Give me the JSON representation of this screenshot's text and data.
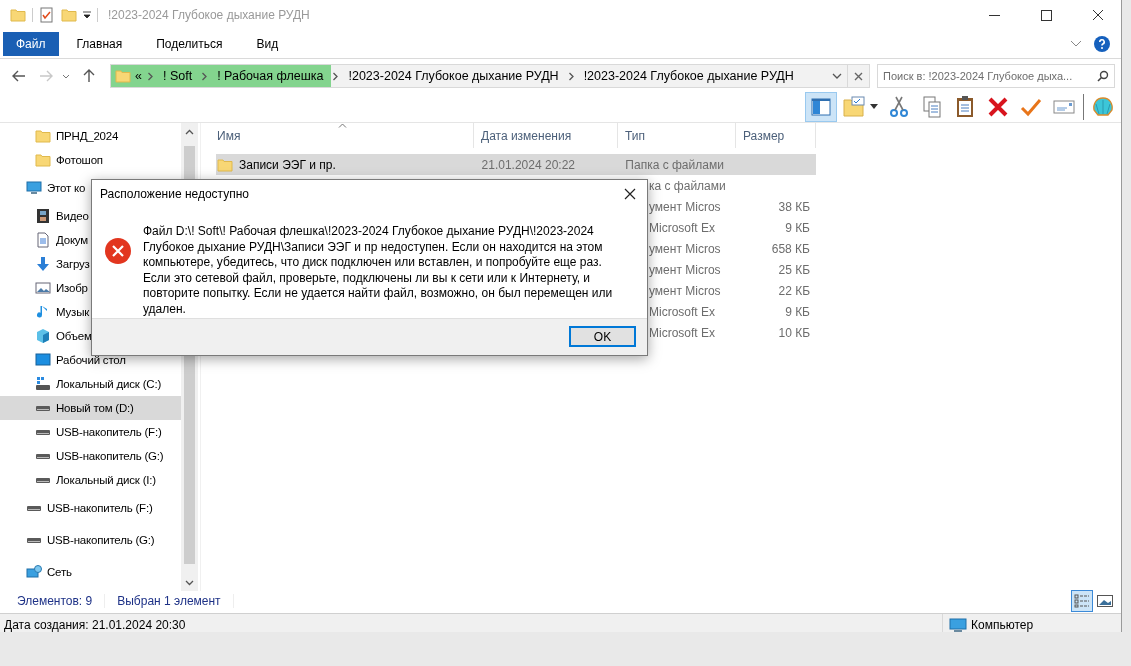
{
  "window": {
    "title": "!2023-2024 Глубокое дыхание РУДН"
  },
  "ribbon": {
    "tabs": [
      {
        "label": "Файл",
        "kind": "file"
      },
      {
        "label": "Главная",
        "kind": "tab"
      },
      {
        "label": "Поделиться",
        "kind": "tab"
      },
      {
        "label": "Вид",
        "kind": "tab"
      }
    ]
  },
  "address": {
    "crumbs": [
      {
        "label": "«",
        "highlighted": true
      },
      {
        "label": "! Soft",
        "highlighted": true
      },
      {
        "label": "! Рабочая флешка",
        "highlighted": true
      },
      {
        "label": "!2023-2024 Глубокое дыхание РУДН",
        "highlighted": false
      },
      {
        "label": "!2023-2024 Глубокое дыхание РУДН",
        "highlighted": false
      }
    ],
    "search": {
      "placeholder": "Поиск в: !2023-2024 Глубокое дыха..."
    }
  },
  "toolbar": {
    "pane_on": true,
    "buttons": [
      {
        "kind": "pane"
      },
      {
        "kind": "folder-options"
      },
      {
        "kind": "cut"
      },
      {
        "kind": "copy"
      },
      {
        "kind": "paste"
      },
      {
        "kind": "delete"
      },
      {
        "kind": "check"
      },
      {
        "kind": "envelope"
      },
      {
        "kind": "shell"
      }
    ]
  },
  "sidebar": {
    "partial_group": [
      {
        "label": "ПРНД_2024",
        "kind": "folder",
        "selected": false
      },
      {
        "label": "Фотошоп",
        "kind": "folder",
        "selected": false
      }
    ],
    "items": [
      {
        "label": "Этот ко",
        "kind": "pc",
        "selected": false,
        "children": [
          {
            "label": "Видео",
            "kind": "video",
            "selected": false
          },
          {
            "label": "Докум",
            "kind": "docs",
            "selected": false
          },
          {
            "label": "Загруз",
            "kind": "download",
            "selected": false
          },
          {
            "label": "Изобр",
            "kind": "images",
            "selected": false
          },
          {
            "label": "Музык",
            "kind": "music",
            "selected": false
          },
          {
            "label": "Объем",
            "kind": "cube",
            "selected": false
          },
          {
            "label": "Рабочий стол",
            "kind": "desktop",
            "selected": false
          },
          {
            "label": "Локальный диск (C:)",
            "kind": "drive-win",
            "selected": false
          },
          {
            "label": "Новый том (D:)",
            "kind": "drive",
            "selected": true
          },
          {
            "label": "USB-накопитель (F:)",
            "kind": "drive",
            "selected": false
          },
          {
            "label": "USB-накопитель (G:)",
            "kind": "drive",
            "selected": false
          },
          {
            "label": "Локальный диск (I:)",
            "kind": "drive",
            "selected": false
          }
        ]
      },
      {
        "label": "USB-накопитель (F:)",
        "kind": "drive",
        "selected": false
      },
      {
        "label": "USB-накопитель (G:)",
        "kind": "drive",
        "selected": false
      },
      {
        "label": "Сеть",
        "kind": "network",
        "selected": false
      }
    ]
  },
  "table": {
    "columns": [
      "Имя",
      "Дата изменения",
      "Тип",
      "Размер"
    ],
    "rows": [
      {
        "name": "Записи ЭЭГ и пр.",
        "date": "21.01.2024 20:22",
        "type": "Папка с файлами",
        "selected": true
      },
      {
        "type_visible": "ка с файлами",
        "selected": false
      },
      {
        "type_visible": "умент Micros",
        "size": "38 КБ",
        "selected": false
      },
      {
        "type_visible": "Microsoft Ex",
        "size": "9 КБ",
        "selected": false
      },
      {
        "type_visible": "умент Micros",
        "size": "658 КБ",
        "selected": false
      },
      {
        "type_visible": "умент Micros",
        "size": "25 КБ",
        "selected": false
      },
      {
        "type_visible": "умент Micros",
        "size": "22 КБ",
        "selected": false
      },
      {
        "type_visible": "Microsoft Ex",
        "size": "9 КБ",
        "selected": false
      },
      {
        "type_visible": "Microsoft Ex",
        "size": "10 КБ",
        "selected": false
      }
    ]
  },
  "status_bar": {
    "items": [
      "Элементов: 9",
      "Выбран 1 элемент"
    ],
    "views": [
      {
        "kind": "details",
        "selected": true
      },
      {
        "kind": "thumbnails",
        "selected": false
      }
    ]
  },
  "details_bar": {
    "text": "Дата создания: 21.01.2024 20:30",
    "location": "Компьютер"
  },
  "dialog": {
    "title": "Расположение недоступно",
    "message": "Файл D:\\! Soft\\! Рабочая флешка\\!2023-2024 Глубокое дыхание РУДН\\!2023-2024 Глубокое дыхание РУДН\\Записи ЭЭГ и пр недоступен. Если он находится на этом компьютере, убедитесь, что диск подключен или вставлен, и попробуйте еще раз. Если это сетевой файл, проверьте, подключены ли вы к сети или к Интернету, и повторите попытку. Если не удается найти файл, возможно, он был перемещен или удален.",
    "button": "OK"
  }
}
